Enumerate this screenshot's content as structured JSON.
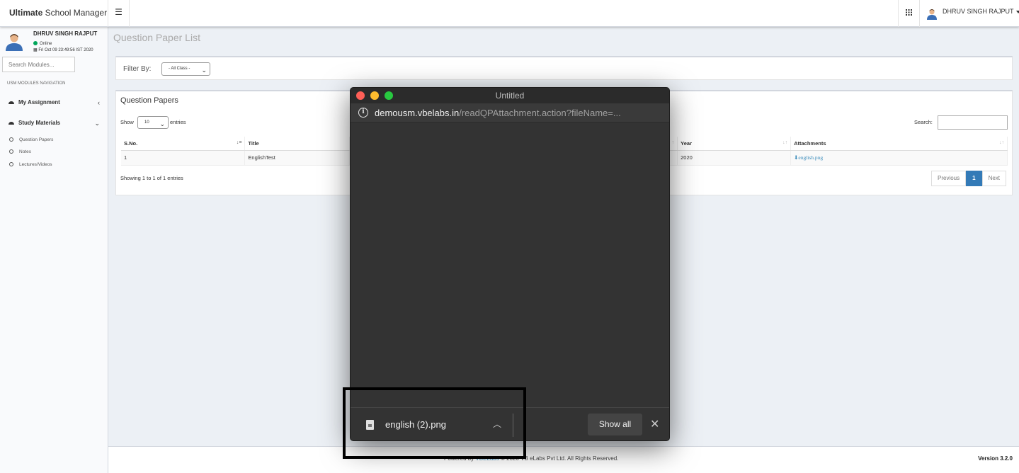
{
  "header": {
    "brand_bold": "Ultimate",
    "brand_rest": " School Manager",
    "menu_toggle_icon": "hamburger-icon",
    "apps_icon": "grid-icon",
    "user_name": "DHRUV SINGH RAJPUT"
  },
  "sidebar": {
    "user_name": "DHRUV SINGH RAJPUT",
    "status": "Online",
    "datetime": "Fri Oct 09 23:49:56 IST 2020",
    "search_placeholder": "Search Modules...",
    "nav_header": "USM MODULES NAVIGATION",
    "items": [
      {
        "label": "My Assignment",
        "chevron": "‹"
      },
      {
        "label": "Study Materials",
        "chevron": "⌄"
      }
    ],
    "sub_items": [
      "Question Papers",
      "Notes",
      "Lectures/Videos"
    ]
  },
  "main": {
    "page_title": "Question Paper List",
    "filter_label": "Filter By:",
    "filter_value": "- All Class -",
    "box_title": "Question Papers",
    "show_label": "Show",
    "page_length": "10",
    "entries_label": "entries",
    "search_label": "Search:",
    "table": {
      "columns": [
        "S.No.",
        "Title",
        "",
        "Year",
        "Attachments"
      ],
      "rows": [
        {
          "sno": "1",
          "title": "EnglishTest",
          "year": "2020",
          "attachment": "english.png"
        }
      ]
    },
    "info": "Showing 1 to 1 of 1 entries",
    "pager": {
      "previous": "Previous",
      "current": "1",
      "next": "Next"
    }
  },
  "footer": {
    "powered_by": "Powered by ",
    "brand_link": "VBELabs",
    "copyright": " © 2020 VB eLabs Pvt Ltd. All Rights Reserved.",
    "version": "Version 3.2.0"
  },
  "popup": {
    "window_title": "Untitled",
    "url_host": "demousm.vbelabs.in",
    "url_path": "/readQPAttachment.action?fileName=...",
    "download_file": "english (2).png",
    "show_all": "Show all",
    "close_symbol": "✕",
    "chevron_symbol": "︿"
  },
  "colors": {
    "accent": "#3c8dbc",
    "online": "#00a65a",
    "pager_active": "#337ab7",
    "popup_bg": "#333333"
  }
}
